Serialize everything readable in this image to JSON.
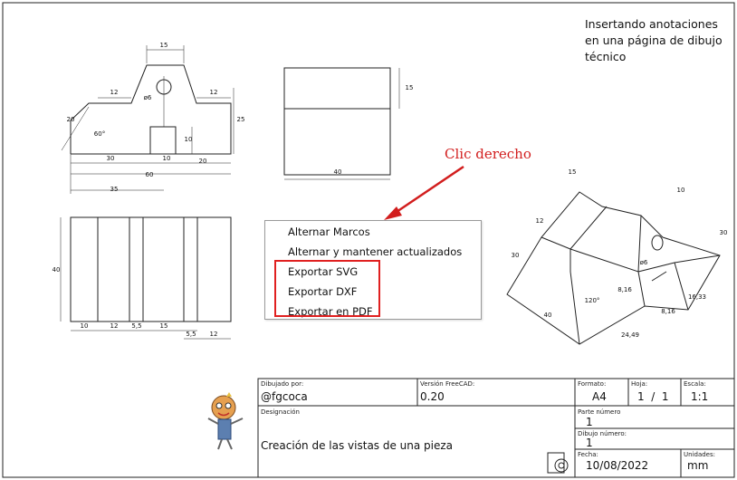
{
  "note": {
    "text": "Insertando anotaciones\nen una página de dibujo\ntécnico"
  },
  "callout": {
    "label": "Clic derecho"
  },
  "context_menu": {
    "items": [
      {
        "label": "Alternar Marcos"
      },
      {
        "label": "Alternar y mantener actualizados"
      },
      {
        "label": "Exportar SVG"
      },
      {
        "label": "Exportar DXF"
      },
      {
        "label": "Exportar en PDF"
      }
    ]
  },
  "title_block": {
    "drawn_by_label": "Dibujado por:",
    "drawn_by": "@fgcoca",
    "version_label": "Versión FreeCAD:",
    "version": "0.20",
    "format_label": "Formato:",
    "format": "A4",
    "sheet_label": "Hoja:",
    "sheet": "1  /  1",
    "scale_label": "Escala:",
    "scale": "1:1",
    "designation_label": "Designación",
    "designation": "Creación de las vistas de una pieza",
    "part_number_label": "Parte número",
    "part_number": "1",
    "drawing_number_label": "Dibujo número:",
    "drawing_number": "1",
    "date_label": "Fecha:",
    "date": "10/08/2022",
    "units_label": "Unidades:",
    "units": "mm"
  },
  "dimensions": {
    "front": [
      "15",
      "12",
      "12",
      "25",
      "20",
      "60°",
      "10",
      "10",
      "30",
      "20",
      "60",
      "35",
      "ø6"
    ],
    "top": [
      "15",
      "40"
    ],
    "side": [
      "40",
      "10",
      "12",
      "5,5",
      "15",
      "5,5",
      "12"
    ],
    "iso": [
      "15",
      "10",
      "12",
      "30",
      "30",
      "ø6",
      "8,16",
      "120°",
      "16,33",
      "8,16",
      "40",
      "24,49"
    ]
  }
}
